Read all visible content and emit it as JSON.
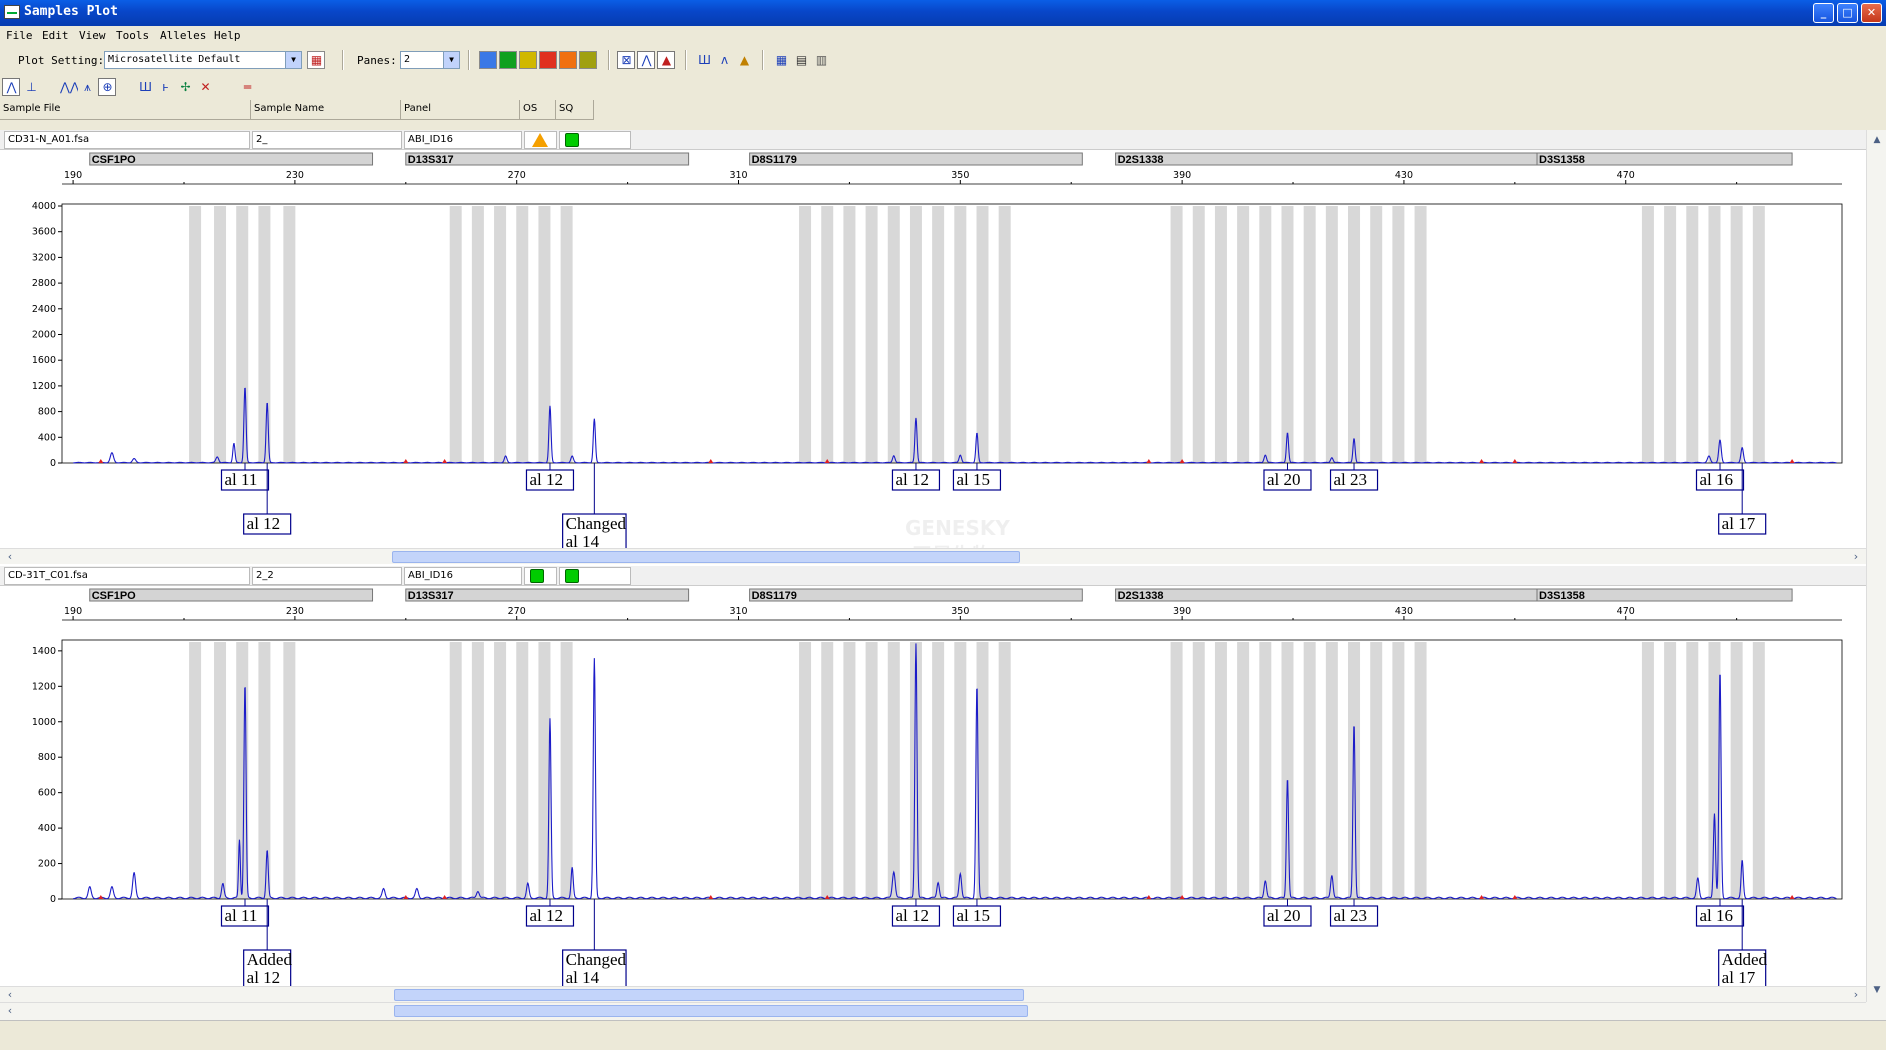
{
  "window": {
    "title": "Samples Plot",
    "controls": [
      "minimize",
      "maximize",
      "close"
    ]
  },
  "menu": {
    "items": [
      "File",
      "Edit",
      "View",
      "Tools",
      "Alleles",
      "Help"
    ]
  },
  "toolbar": {
    "plot_setting_label": "Plot Setting:",
    "plot_setting_value": "Microsatellite Default",
    "panes_label": "Panes:",
    "panes_value": "2",
    "dye_colors": [
      "#3a78e6",
      "#10a020",
      "#d0b800",
      "#e03020",
      "#f07010",
      "#a0a010"
    ],
    "button_icons": [
      "show-all-icon",
      "overlay-icon",
      "peak-icon",
      "bins-icon",
      "labels-icon",
      "allele-icon",
      "sizing-icon",
      "stack-icon",
      "grid-icon",
      "table-icon",
      "report-icon"
    ]
  },
  "columns": {
    "headers": [
      "Sample File",
      "Sample Name",
      "Panel",
      "OS",
      "SQ"
    ]
  },
  "panes": [
    {
      "sample_file": "CD31-N_A01.fsa",
      "sample_name": "2_",
      "panel": "ABI_ID16",
      "os_status": "warning",
      "sq_status": "pass",
      "y_ticks": [
        0,
        400,
        800,
        1200,
        1600,
        2000,
        2400,
        2800,
        3200,
        3600,
        4000
      ],
      "y_max": 4000,
      "peaks": [
        {
          "size": 197,
          "rfu": 150,
          "w": 0.9
        },
        {
          "size": 201,
          "rfu": 60,
          "w": 0.9
        },
        {
          "size": 216,
          "rfu": 90,
          "w": 0.8
        },
        {
          "size": 219,
          "rfu": 300,
          "w": 0.6
        },
        {
          "size": 221,
          "rfu": 1180,
          "w": 0.6
        },
        {
          "size": 225,
          "rfu": 940,
          "w": 0.6
        },
        {
          "size": 268,
          "rfu": 100,
          "w": 0.7
        },
        {
          "size": 276,
          "rfu": 880,
          "w": 0.6
        },
        {
          "size": 280,
          "rfu": 100,
          "w": 0.7
        },
        {
          "size": 284,
          "rfu": 680,
          "w": 0.6
        },
        {
          "size": 338,
          "rfu": 110,
          "w": 0.7
        },
        {
          "size": 342,
          "rfu": 700,
          "w": 0.6
        },
        {
          "size": 350,
          "rfu": 120,
          "w": 0.7
        },
        {
          "size": 353,
          "rfu": 460,
          "w": 0.6
        },
        {
          "size": 405,
          "rfu": 120,
          "w": 0.7
        },
        {
          "size": 409,
          "rfu": 470,
          "w": 0.6
        },
        {
          "size": 417,
          "rfu": 80,
          "w": 0.7
        },
        {
          "size": 421,
          "rfu": 380,
          "w": 0.6
        },
        {
          "size": 485,
          "rfu": 100,
          "w": 0.8
        },
        {
          "size": 487,
          "rfu": 350,
          "w": 0.7
        },
        {
          "size": 491,
          "rfu": 230,
          "w": 0.7
        }
      ],
      "alleles": [
        {
          "lines": [
            "al 11"
          ],
          "size": 221,
          "row": 0
        },
        {
          "lines": [
            "al 12"
          ],
          "size": 225,
          "row": 1
        },
        {
          "lines": [
            "al 12"
          ],
          "size": 276,
          "row": 0
        },
        {
          "lines": [
            "Changed",
            "al 14"
          ],
          "size": 284,
          "row": 1
        },
        {
          "lines": [
            "al 12"
          ],
          "size": 342,
          "row": 0
        },
        {
          "lines": [
            "al 15"
          ],
          "size": 353,
          "row": 0
        },
        {
          "lines": [
            "al 20"
          ],
          "size": 409,
          "row": 0
        },
        {
          "lines": [
            "al 23"
          ],
          "size": 421,
          "row": 0
        },
        {
          "lines": [
            "al 16"
          ],
          "size": 487,
          "row": 0
        },
        {
          "lines": [
            "al 17"
          ],
          "size": 491,
          "row": 1
        }
      ]
    },
    {
      "sample_file": "CD-31T_C01.fsa",
      "sample_name": "2_2",
      "panel": "ABI_ID16",
      "os_status": "pass",
      "sq_status": "pass",
      "y_ticks": [
        0,
        200,
        400,
        600,
        800,
        1000,
        1200,
        1400
      ],
      "y_max": 1450,
      "peaks": [
        {
          "size": 193,
          "rfu": 60,
          "w": 0.8
        },
        {
          "size": 197,
          "rfu": 60,
          "w": 0.8
        },
        {
          "size": 201,
          "rfu": 140,
          "w": 0.8
        },
        {
          "size": 217,
          "rfu": 80,
          "w": 0.7
        },
        {
          "size": 220,
          "rfu": 330,
          "w": 0.5
        },
        {
          "size": 221,
          "rfu": 1210,
          "w": 0.6
        },
        {
          "size": 225,
          "rfu": 270,
          "w": 0.6
        },
        {
          "size": 246,
          "rfu": 50,
          "w": 0.8
        },
        {
          "size": 252,
          "rfu": 50,
          "w": 0.8
        },
        {
          "size": 263,
          "rfu": 40,
          "w": 0.8
        },
        {
          "size": 272,
          "rfu": 80,
          "w": 0.7
        },
        {
          "size": 276,
          "rfu": 1010,
          "w": 0.6
        },
        {
          "size": 280,
          "rfu": 170,
          "w": 0.6
        },
        {
          "size": 284,
          "rfu": 1350,
          "w": 0.6
        },
        {
          "size": 338,
          "rfu": 150,
          "w": 0.8
        },
        {
          "size": 342,
          "rfu": 1440,
          "w": 0.6
        },
        {
          "size": 346,
          "rfu": 90,
          "w": 0.7
        },
        {
          "size": 350,
          "rfu": 140,
          "w": 0.7
        },
        {
          "size": 353,
          "rfu": 1200,
          "w": 0.6
        },
        {
          "size": 405,
          "rfu": 100,
          "w": 0.7
        },
        {
          "size": 409,
          "rfu": 680,
          "w": 0.6
        },
        {
          "size": 417,
          "rfu": 130,
          "w": 0.7
        },
        {
          "size": 421,
          "rfu": 990,
          "w": 0.6
        },
        {
          "size": 483,
          "rfu": 110,
          "w": 0.7
        },
        {
          "size": 486,
          "rfu": 480,
          "w": 0.6
        },
        {
          "size": 487,
          "rfu": 1280,
          "w": 0.6
        },
        {
          "size": 491,
          "rfu": 210,
          "w": 0.6
        }
      ],
      "alleles": [
        {
          "lines": [
            "al 11"
          ],
          "size": 221,
          "row": 0
        },
        {
          "lines": [
            "Added",
            "al 12"
          ],
          "size": 225,
          "row": 1
        },
        {
          "lines": [
            "al 12"
          ],
          "size": 276,
          "row": 0
        },
        {
          "lines": [
            "Changed",
            "al 14"
          ],
          "size": 284,
          "row": 1
        },
        {
          "lines": [
            "al 12"
          ],
          "size": 342,
          "row": 0
        },
        {
          "lines": [
            "al 15"
          ],
          "size": 353,
          "row": 0
        },
        {
          "lines": [
            "al 20"
          ],
          "size": 409,
          "row": 0
        },
        {
          "lines": [
            "al 23"
          ],
          "size": 421,
          "row": 0
        },
        {
          "lines": [
            "al 16"
          ],
          "size": 487,
          "row": 0
        },
        {
          "lines": [
            "Added",
            "al 17"
          ],
          "size": 491,
          "row": 1
        }
      ]
    }
  ],
  "plot": {
    "x_ticks": [
      190,
      230,
      270,
      310,
      350,
      390,
      430,
      470
    ],
    "x_min": 188,
    "x_max": 509,
    "markers": [
      {
        "name": "CSF1PO",
        "start": 193,
        "end": 244
      },
      {
        "name": "D13S317",
        "start": 250,
        "end": 301
      },
      {
        "name": "D8S1179",
        "start": 312,
        "end": 372
      },
      {
        "name": "D2S1338",
        "start": 378,
        "end": 455
      },
      {
        "name": "D3S1358",
        "start": 454,
        "end": 500
      }
    ],
    "bins": [
      212,
      216.5,
      220.5,
      224.5,
      229,
      259,
      263,
      267,
      271,
      275,
      279,
      322,
      326,
      330,
      334,
      338,
      342,
      346,
      350,
      354,
      358,
      389,
      393,
      397,
      401,
      405,
      409,
      413,
      417,
      421,
      425,
      429,
      433,
      474,
      478,
      482,
      486,
      490,
      494
    ],
    "bin_color": "#d8d8d8",
    "trace_color": "#1c1cc8",
    "size_std_markers": [
      195,
      250,
      257,
      305,
      326,
      384,
      390,
      444,
      450,
      500
    ]
  },
  "watermark": {
    "line1": "GENESKY",
    "line2": "天昊生物"
  }
}
